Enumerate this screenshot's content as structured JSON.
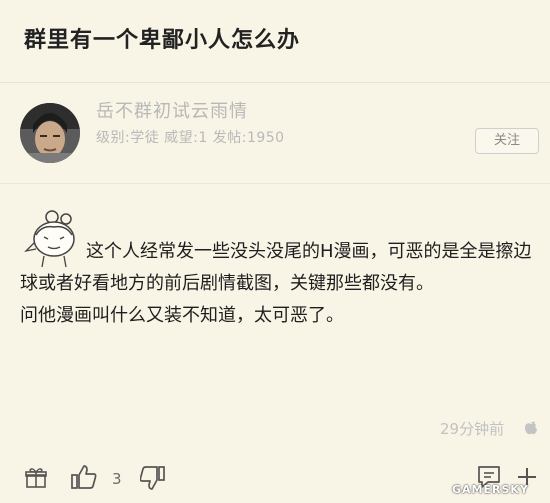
{
  "page": {
    "title": "群里有一个卑鄙小人怎么办"
  },
  "user": {
    "name": "岳不群初试云雨情",
    "meta": "级别:学徒 威望:1 发帖:1950",
    "follow_label": "关注"
  },
  "post": {
    "line1": "这个人经常发一些没头没尾的H漫画，可恶的是全是擦边球或者好看地方的前后剧情截图，关键那些都没有。",
    "line2": "问他漫画叫什么又装不知道，太可恶了。",
    "time": "29分钟前"
  },
  "toolbar": {
    "like_count": "3",
    "icons": [
      "gift-icon",
      "thumbs-up-icon",
      "thumbs-down-icon",
      "comment-icon",
      "plus-icon"
    ]
  },
  "watermark": "GAMERSKY"
}
